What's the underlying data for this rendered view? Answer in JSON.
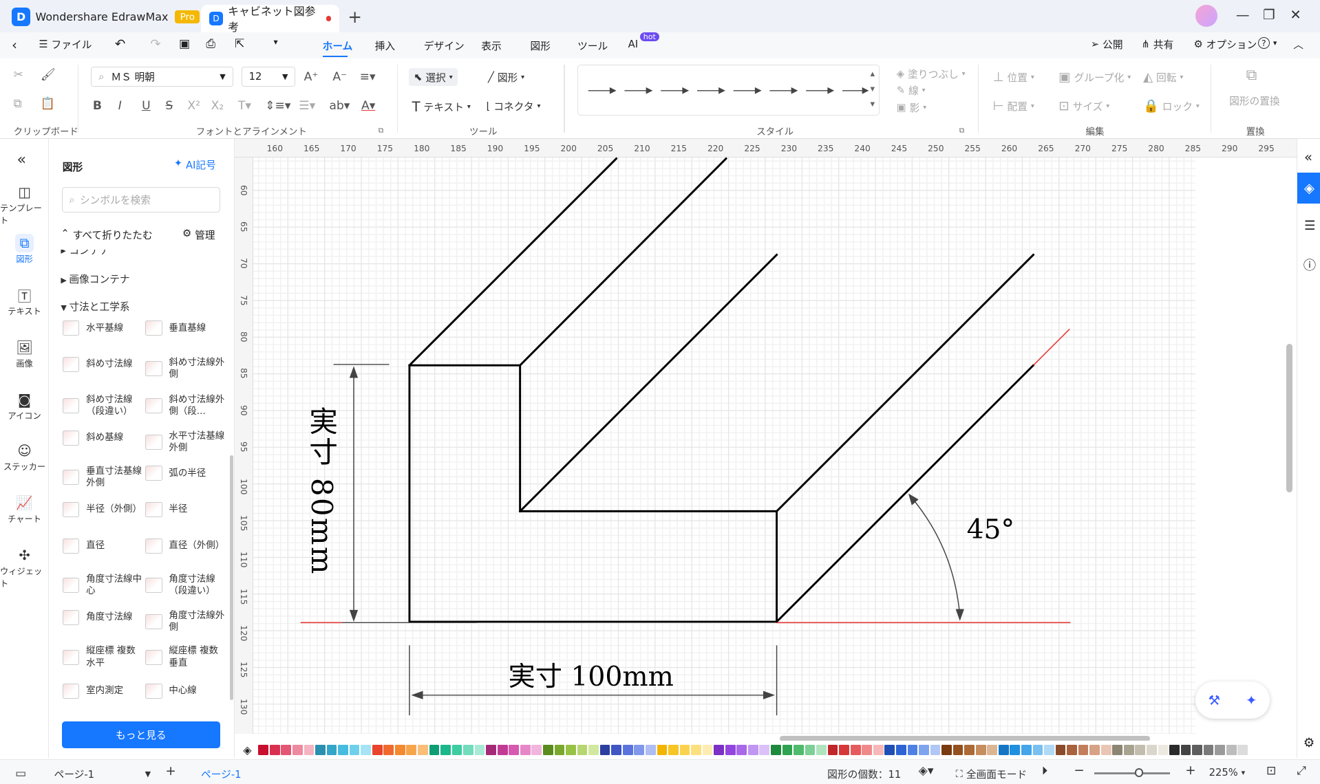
{
  "titlebar": {
    "app_name": "Wondershare EdrawMax",
    "pro_badge": "Pro",
    "doc_tab": "キャビネット図参考",
    "new_tab": "+",
    "min": "—",
    "max": "❐",
    "close": "✕"
  },
  "menubar": {
    "file": "ファイル",
    "tabs": [
      "ホーム",
      "挿入",
      "デザイン",
      "表示",
      "図形",
      "ツール",
      "AI"
    ],
    "hot": "hot",
    "publish": "公開",
    "share": "共有",
    "options": "オプション",
    "help": "?"
  },
  "ribbon": {
    "groups": [
      "クリップボード",
      "フォントとアラインメント",
      "ツール",
      "スタイル",
      "編集",
      "置換"
    ],
    "font_name": "ＭＳ 明朝",
    "font_size": "12",
    "select": "選択",
    "shape": "図形",
    "text": "テキスト",
    "connector": "コネクタ",
    "fill": "塗りつぶし",
    "line": "線",
    "shadow": "影",
    "position": "位置",
    "group": "グループ化",
    "rotate": "回転",
    "align": "配置",
    "size": "サイズ",
    "lock": "ロック",
    "replace_shape": "図形の置換"
  },
  "rail": [
    "テンプレート",
    "図形",
    "テキスト",
    "画像",
    "アイコン",
    "ステッカー",
    "チャート",
    "ウィジェット"
  ],
  "library": {
    "title": "図形",
    "ai_symbol": "AI記号",
    "search_placeholder": "シンボルを検索",
    "collapse_all": "すべて折りたたむ",
    "manage": "管理",
    "partial_cat": "コンテナ",
    "cat_image": "画像コンテナ",
    "cat_dim": "寸法と工学系",
    "symbols": [
      "水平基線",
      "垂直基線",
      "斜め寸法線",
      "斜め寸法線外側",
      "斜め寸法線（段違い）",
      "斜め寸法線外側（段...",
      "斜め基線",
      "水平寸法基線外側",
      "垂直寸法基線外側",
      "弧の半径",
      "半径（外側）",
      "半径",
      "直径",
      "直径（外側）",
      "角度寸法線中心",
      "角度寸法線（段違い）",
      "角度寸法線",
      "角度寸法線外側",
      "縦座標 複数水平",
      "縦座標 複数垂直",
      "室内測定",
      "中心線"
    ],
    "more": "もっと見る"
  },
  "ruler": {
    "h": [
      "160",
      "165",
      "170",
      "175",
      "180",
      "185",
      "190",
      "195",
      "200",
      "205",
      "210",
      "215",
      "220",
      "225",
      "230",
      "235",
      "240",
      "245",
      "250",
      "255",
      "260",
      "265",
      "270",
      "275",
      "280",
      "285",
      "290",
      "295"
    ],
    "v": [
      "60",
      "65",
      "70",
      "75",
      "80",
      "85",
      "90",
      "95",
      "100",
      "105",
      "110",
      "115",
      "120",
      "125",
      "130"
    ]
  },
  "drawing": {
    "height_label": "実寸 80mm",
    "width_label": "実寸 100mm",
    "angle_label": "45°"
  },
  "colors": [
    "#c8102e",
    "#d9304f",
    "#e35674",
    "#ee8aa0",
    "#f4b4c2",
    "#2b8fb0",
    "#34a6c7",
    "#46bde0",
    "#6fd0ea",
    "#a6e3f4",
    "#e8452c",
    "#f06a2f",
    "#f4892f",
    "#f7a54d",
    "#fabe78",
    "#0f9d74",
    "#1cb78a",
    "#3dcda1",
    "#72dcbc",
    "#a8ead5",
    "#a42a78",
    "#c23b93",
    "#d65ab0",
    "#e688c8",
    "#f1b5de",
    "#5a8c1e",
    "#7aa82c",
    "#98c245",
    "#b6d670",
    "#d2e8a1",
    "#2c3fa0",
    "#3f56c4",
    "#5b74dd",
    "#8197ea",
    "#aebdf3",
    "#f3b400",
    "#f7c525",
    "#fad24f",
    "#fce07f",
    "#fdedb2",
    "#7a31c4",
    "#9346de",
    "#a968ea",
    "#c195f2",
    "#dbc1f8",
    "#1e8a3e",
    "#2ea350",
    "#4fbb6c",
    "#7dd096",
    "#b0e4bf",
    "#c0262a",
    "#d6383a",
    "#e65c5c",
    "#f08a8a",
    "#f6b8b8",
    "#1f4fb5",
    "#2d63d4",
    "#4f80e5",
    "#7ea3ef",
    "#b1c8f6",
    "#7a3b10",
    "#94501f",
    "#ad6a36",
    "#c68d5f",
    "#dcb593",
    "#1577c4",
    "#1f8fe0",
    "#43a6ea",
    "#78c0f1",
    "#afd9f7",
    "#8a4b2a",
    "#a8623d",
    "#c27e5c",
    "#d8a285",
    "#e9c6b3",
    "#8c8574",
    "#a8a290",
    "#c2bdae",
    "#dad6cb",
    "#ece9e0",
    "#2b2b2b",
    "#444444",
    "#5e5e5e",
    "#7a7a7a",
    "#9a9a9a",
    "#bcbcbc",
    "#dcdcdc"
  ],
  "status": {
    "page_selector": "ページ-1",
    "active_page": "ページ-1",
    "shape_count": "図形の個数：11",
    "fullscreen": "全画面モード",
    "zoom": "225%"
  }
}
